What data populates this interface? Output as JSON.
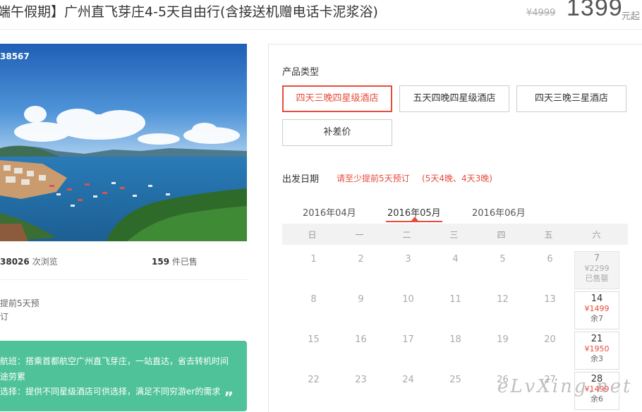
{
  "header": {
    "title": "端午假期】广州直飞芽庄4-5天自由行(含接送机赠电话卡泥浆浴)",
    "old_price": "¥4999",
    "price": "1399",
    "price_unit": "元起"
  },
  "left": {
    "photo_id": "38567",
    "views_count": "38026",
    "views_label": " 次浏览",
    "sold_count": "159",
    "sold_label": " 件已售",
    "note_line1": "提前5天预",
    "note_line2": "订",
    "features": [
      "航班：搭乘首都航空广州直飞芽庄，一站直达，省去转机时间",
      "途劳累",
      "选择：提供不同星级酒店可供选择，满足不同穷游er的需求"
    ],
    "quote_mark": "„"
  },
  "product": {
    "type_label": "产品类型",
    "options": [
      {
        "label": "四天三晚四星级酒店",
        "selected": true
      },
      {
        "label": "五天四晚四星级酒店",
        "selected": false
      },
      {
        "label": "四天三晚三星酒店",
        "selected": false
      },
      {
        "label": "补差价",
        "selected": false
      }
    ]
  },
  "date": {
    "label": "出发日期",
    "hint1": "请至少提前5天预订",
    "hint2": "(5天4晚、4天3晚)",
    "months": [
      "2016年04月",
      "2016年05月",
      "2016年06月"
    ],
    "active_month": "2016年05月",
    "weekdays": [
      "日",
      "一",
      "二",
      "三",
      "四",
      "五",
      "六"
    ],
    "rows": [
      {
        "days": [
          "1",
          "2",
          "3",
          "4",
          "5",
          "6"
        ],
        "sat": {
          "day": "7",
          "price": "¥2299",
          "remain": "已售罄",
          "past": true
        }
      },
      {
        "days": [
          "8",
          "9",
          "10",
          "11",
          "12",
          "13"
        ],
        "sat": {
          "day": "14",
          "price": "¥1499",
          "remain": "余7",
          "past": false
        }
      },
      {
        "days": [
          "15",
          "16",
          "17",
          "18",
          "19",
          "20"
        ],
        "sat": {
          "day": "21",
          "price": "¥1950",
          "remain": "余3",
          "past": false
        }
      },
      {
        "days": [
          "22",
          "23",
          "24",
          "25",
          "26",
          "27"
        ],
        "sat": {
          "day": "28",
          "price": "¥1499",
          "remain": "余6",
          "past": false
        }
      }
    ]
  },
  "watermark": "eLvXing.net",
  "colors": {
    "accent": "#e74c3c",
    "feature_bg": "#4fc29a",
    "border": "#cccccc"
  }
}
